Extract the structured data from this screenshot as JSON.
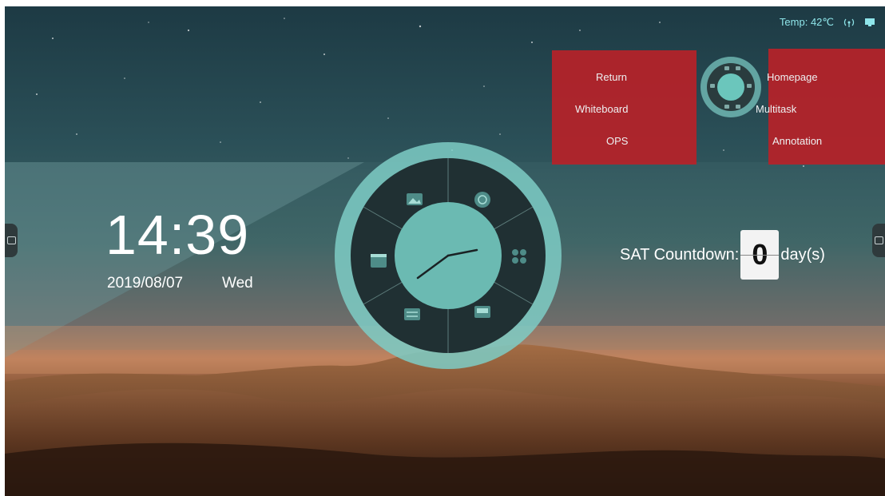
{
  "status_bar": {
    "temp_label": "Temp:",
    "temp_value": "42℃",
    "icons": [
      "wireless-icon",
      "monitor-icon"
    ]
  },
  "clock": {
    "time": "14:39",
    "date": "2019/08/07",
    "weekday": "Wed"
  },
  "wheel": {
    "segments": [
      "gallery-icon",
      "browser-icon",
      "apps-icon",
      "screen-share-icon",
      "settings-panel-icon",
      "calendar-icon"
    ]
  },
  "countdown": {
    "prefix": "SAT Countdown:",
    "digit": "0",
    "suffix": "day(s)"
  },
  "quick_menu": {
    "left": [
      "Return",
      "Whiteboard",
      "OPS"
    ],
    "right": [
      "Homepage",
      "Multitask",
      "Annotation"
    ]
  },
  "colors": {
    "menu_red": "#b72229",
    "teal_ring": "#7ecdc6",
    "status_text": "#8fe6ea"
  }
}
